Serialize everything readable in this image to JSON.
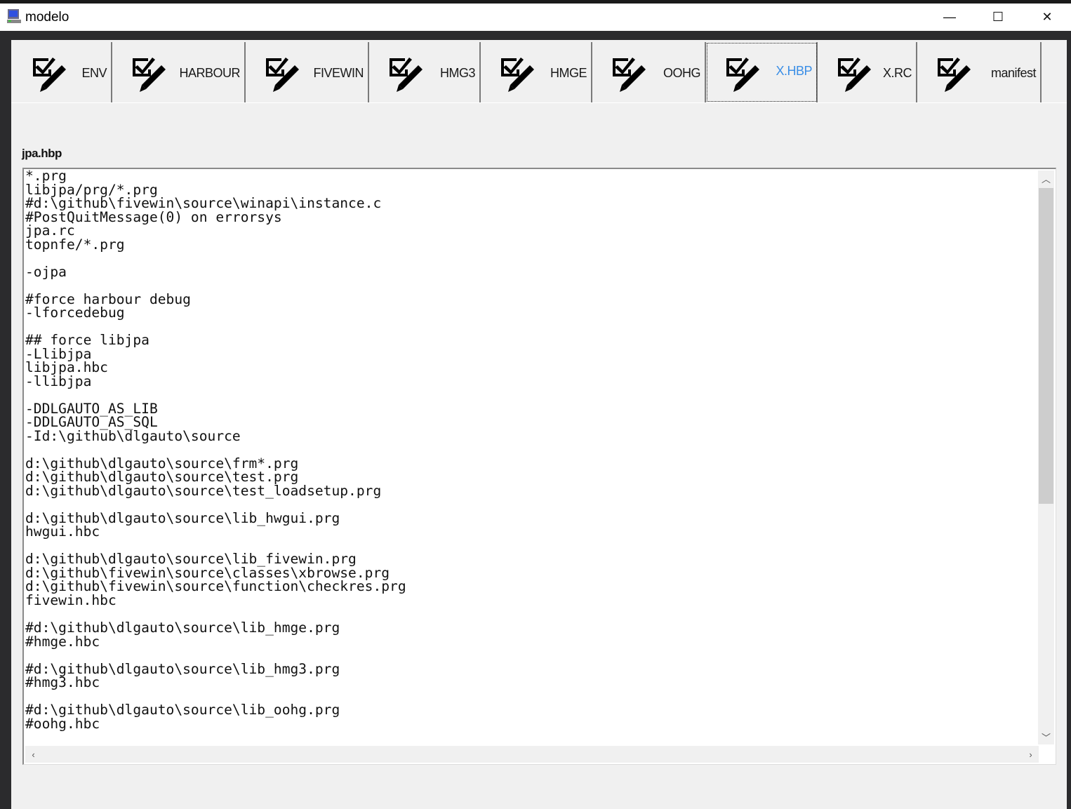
{
  "window": {
    "title": "modelo",
    "minimize": "—",
    "maximize": "☐",
    "close": "✕"
  },
  "tabs": [
    {
      "label": "ENV",
      "icon": "check-edit-icon"
    },
    {
      "label": "HARBOUR",
      "icon": "check-edit-icon"
    },
    {
      "label": "FIVEWIN",
      "icon": "check-edit-icon"
    },
    {
      "label": "HMG3",
      "icon": "check-edit-icon"
    },
    {
      "label": "HMGE",
      "icon": "check-edit-icon"
    },
    {
      "label": "OOHG",
      "icon": "check-edit-icon"
    },
    {
      "label": "X.HBP",
      "icon": "check-edit-icon",
      "selected": true
    },
    {
      "label": "X.RC",
      "icon": "check-edit-icon"
    },
    {
      "label": "manifest",
      "icon": "check-edit-icon"
    }
  ],
  "accent_color": "#3a8ee6",
  "editor": {
    "file_label": "jpa.hbp",
    "lines": [
      "*.prg",
      "libjpa/prg/*.prg",
      "#d:\\github\\fivewin\\source\\winapi\\instance.c",
      "#PostQuitMessage(0) on errorsys",
      "jpa.rc",
      "topnfe/*.prg",
      "",
      "-ojpa",
      "",
      "#force harbour debug",
      "-lforcedebug",
      "",
      "## force libjpa",
      "-Llibjpa",
      "libjpa.hbc",
      "-llibjpa",
      "",
      "-DDLGAUTO_AS_LIB",
      "-DDLGAUTO_AS_SQL",
      "-Id:\\github\\dlgauto\\source",
      "",
      "d:\\github\\dlgauto\\source\\frm*.prg",
      "d:\\github\\dlgauto\\source\\test.prg",
      "d:\\github\\dlgauto\\source\\test_loadsetup.prg",
      "",
      "d:\\github\\dlgauto\\source\\lib_hwgui.prg",
      "hwgui.hbc",
      "",
      "d:\\github\\dlgauto\\source\\lib_fivewin.prg",
      "d:\\github\\fivewin\\source\\classes\\xbrowse.prg",
      "d:\\github\\fivewin\\source\\function\\checkres.prg",
      "fivewin.hbc",
      "",
      "#d:\\github\\dlgauto\\source\\lib_hmge.prg",
      "#hmge.hbc",
      "",
      "#d:\\github\\dlgauto\\source\\lib_hmg3.prg",
      "#hmg3.hbc",
      "",
      "#d:\\github\\dlgauto\\source\\lib_oohg.prg",
      "#oohg.hbc"
    ]
  },
  "scroll": {
    "vertical_position": 0,
    "vertical_visible_fraction": 0.55
  }
}
